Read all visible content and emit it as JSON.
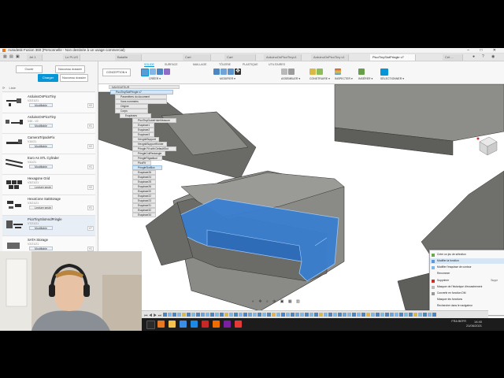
{
  "window": {
    "title": "Autodesk Fusion 360 (Personnelle - Non destinée à un usage commercial)",
    "controls": "– □ ✕"
  },
  "tabs": [
    {
      "label": "Jet 1"
    },
    {
      "label": "Le PLUS"
    },
    {
      "label": "Bataille"
    },
    {
      "label": "Cart"
    },
    {
      "label": "Cart"
    },
    {
      "label": "ArduinoOnPicoTinyv1"
    },
    {
      "label": "ArduinoOnPicoTiny v1"
    },
    {
      "label": "PicoTinySlotPringle v7"
    },
    {
      "label": "Cet ... "
    }
  ],
  "data_panel": {
    "buttons": {
      "upload": "Charger",
      "new_project": "Nouveau dossier",
      "open": "Ouvrir"
    },
    "tool_labels": [
      "⟳",
      "Liste",
      "Trier"
    ],
    "items": [
      {
        "name": "ArduinoOnPicoTiny",
        "version": "V2/21/21",
        "status": "Modifiable",
        "badge": "V2"
      },
      {
        "name": "ArduinoOnPicoTiny",
        "version": "V45 - V2",
        "status": "Modifiable",
        "badge": "V1"
      },
      {
        "name": "CameraTripodeFix",
        "version": "V10/21",
        "status": "Modifiable",
        "badge": "V2"
      },
      {
        "name": "Euro As STL Cylinder",
        "version": "V41/21",
        "status": "Modifiable",
        "badge": "V1"
      },
      {
        "name": "Hexagone Grid",
        "version": "V3/21/21",
        "status": "Lecture seule",
        "badge": "V2"
      },
      {
        "name": "HexaCone SatStorage",
        "version": "V3/21/21",
        "status": "Lecture seule",
        "badge": "V1"
      },
      {
        "name": "PicoTinySlotAndPringle",
        "version": "V7/21/21",
        "status": "Modifiable",
        "badge": "V7"
      },
      {
        "name": "SATA Storage",
        "version": "V2/21/21",
        "status": "Modifiable",
        "badge": "V1"
      }
    ]
  },
  "toolbar": {
    "workspace": "CONCEPTION ▾",
    "tabs": [
      "SOLIDE",
      "SURFACE",
      "MAILLAGE",
      "TÔLERIE",
      "PLASTIQUE",
      "UTILITAIRES"
    ],
    "groups": [
      {
        "label": "CRÉER ▾"
      },
      {
        "label": "MODIFIER ▾"
      },
      {
        "label": "ASSEMBLER ▾"
      },
      {
        "label": "CONSTRUIRE ▾"
      },
      {
        "label": "INSPECTER ▾"
      },
      {
        "label": "INSÉRER ▾"
      },
      {
        "label": "SÉLECTIONNER ▾"
      }
    ]
  },
  "browser": {
    "header": "NAVIGATEUR",
    "root": "PicoTinySlotPringle v7",
    "nodes": [
      "Paramètres du document",
      "Vues nommées",
      "Origine",
      "Corps",
      "Esquisses",
      "PicoTinyGuideHoleMeasure",
      "Esquisse1",
      "Esquisse2",
      "Esquisse3",
      "HexgridSupport",
      "HexgridSupportHolder",
      "Pringle Fit with DefaultSlot",
      "PringleCutRectangle",
      "PringleFitgadtool",
      "PicoFit",
      "PringleSlotBox",
      "Esquisse26",
      "Esquisse24",
      "Esquisse25",
      "Esquisse26",
      "Esquisse20",
      "Esquisse22",
      "Esquisse23",
      "Esquisse31",
      "Esquisse32",
      "Esquisse34"
    ]
  },
  "context_menu": {
    "items": [
      {
        "label": "Créer un jeu de sélection",
        "shortcut": ""
      },
      {
        "label": "Modifier la fonction",
        "shortcut": ""
      },
      {
        "label": "Modifier l'esquisse de contour",
        "shortcut": ""
      },
      {
        "label": "Renommer",
        "shortcut": ""
      },
      {
        "label": "Supprimer",
        "shortcut": "Suppr"
      },
      {
        "label": "Masquer de l'historique d'encastrement",
        "shortcut": ""
      },
      {
        "label": "Convertir en fonction DM",
        "shortcut": ""
      },
      {
        "label": "Masquer les fonctions",
        "shortcut": ""
      },
      {
        "label": "Rechercher dans le navigateur",
        "shortcut": ""
      },
      {
        "label": "Rechercher dans la fenêtre",
        "shortcut": ""
      }
    ]
  },
  "taskbar": {
    "language": "FRA\nBEFR",
    "time": "14:40",
    "date": "21/06/2021"
  },
  "colors": {
    "accent": "#0696d7",
    "selection_face": "#3a7fd0",
    "model_gray": "#8a8a8a",
    "model_dark": "#5a5a56"
  }
}
